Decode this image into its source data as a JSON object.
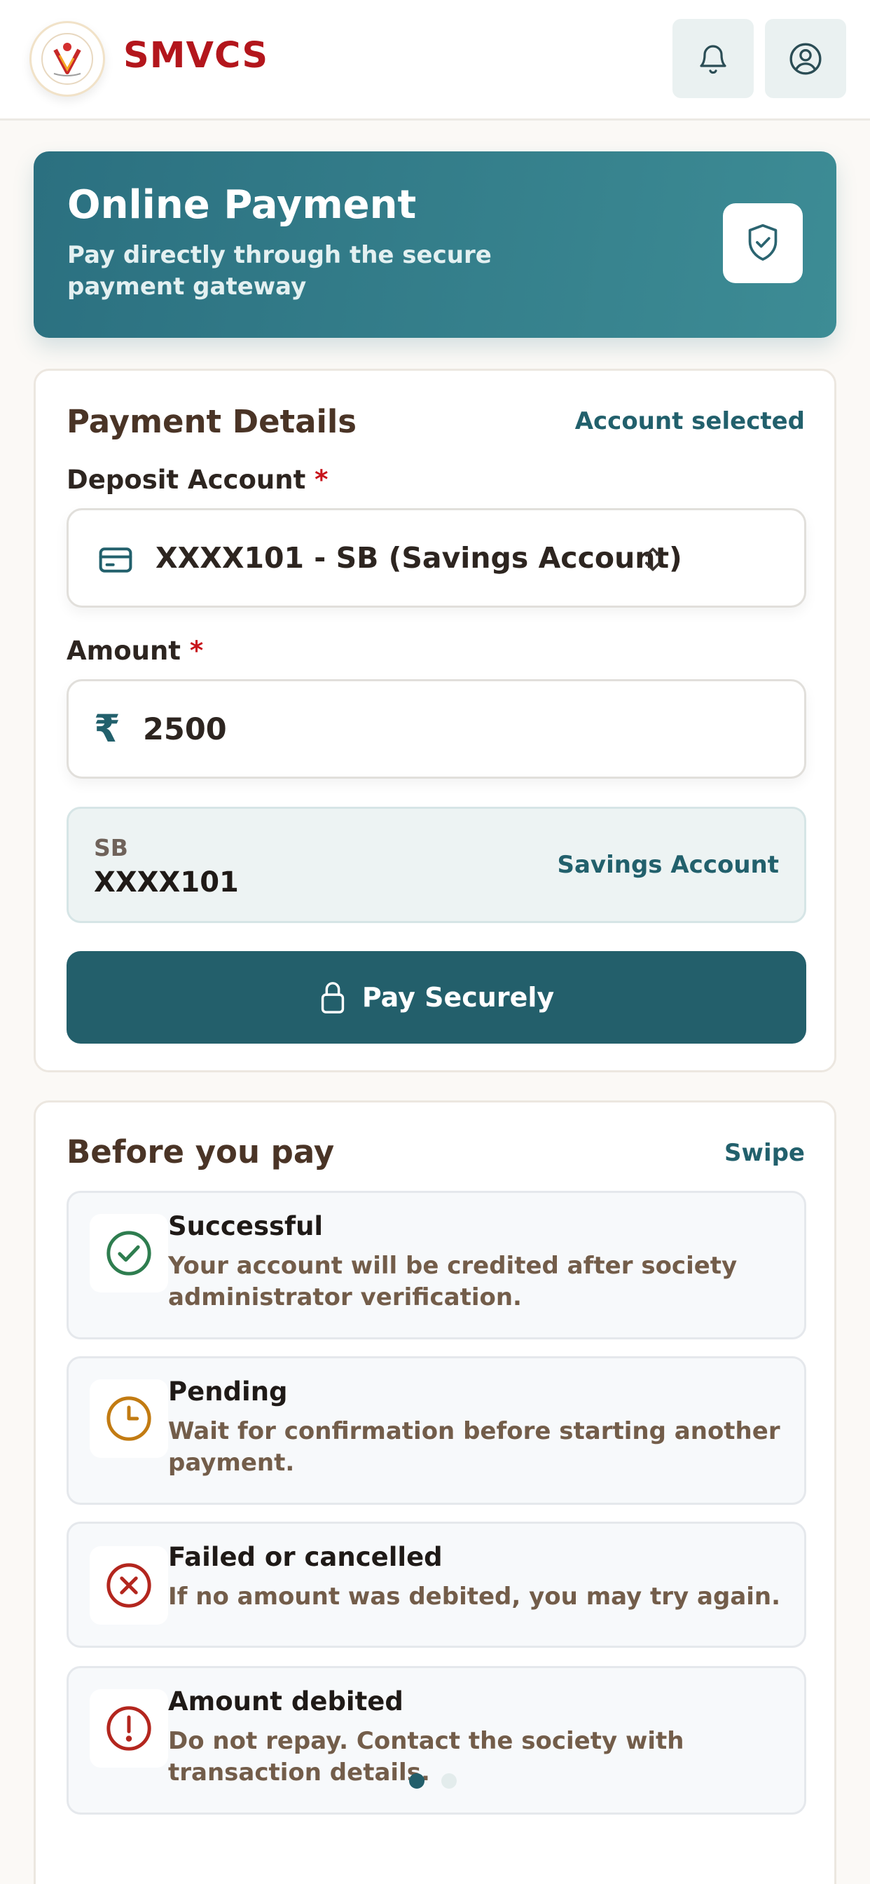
{
  "header": {
    "brand": "SMVCS",
    "logo_icon": "society-logo-icon",
    "notifications_icon": "bell-icon",
    "profile_icon": "user-circle-icon"
  },
  "banner": {
    "title": "Online Payment",
    "subtitle": "Pay directly through the secure payment gateway",
    "icon": "shield-check-icon"
  },
  "payment_details": {
    "title": "Payment Details",
    "status": "Account selected",
    "deposit_label": "Deposit Account",
    "required_mark": "*",
    "deposit_value": "XXXX101 - SB (Savings Account)",
    "amount_label": "Amount",
    "currency_symbol": "₹",
    "amount_value": "2500",
    "account_type": "SB",
    "account_number": "XXXX101",
    "account_name": "Savings Account",
    "pay_button": "Pay Securely"
  },
  "before_you_pay": {
    "title": "Before you pay",
    "hint": "Swipe",
    "items": [
      {
        "title": "Successful",
        "description": "Your account will be credited after society administrator verification.",
        "icon": "check-circle-icon",
        "color": "#2e7d4f"
      },
      {
        "title": "Pending",
        "description": "Wait for confirmation before starting another payment.",
        "icon": "clock-icon",
        "color": "#c27b12"
      },
      {
        "title": "Failed or cancelled",
        "description": "If no amount was debited, you may try again.",
        "icon": "x-circle-icon",
        "color": "#b3261e"
      },
      {
        "title": "Amount debited",
        "description": "Do not repay. Contact the society with transaction details.",
        "icon": "alert-circle-icon",
        "color": "#b3261e"
      }
    ],
    "pager": {
      "pages": 2,
      "current": 1
    }
  },
  "colors": {
    "brand_red": "#b3161c",
    "teal_primary": "#235f6b",
    "teal_banner": "#3d8c95",
    "dot_active": "#235f6b",
    "dot_inactive": "#e3ecec"
  }
}
